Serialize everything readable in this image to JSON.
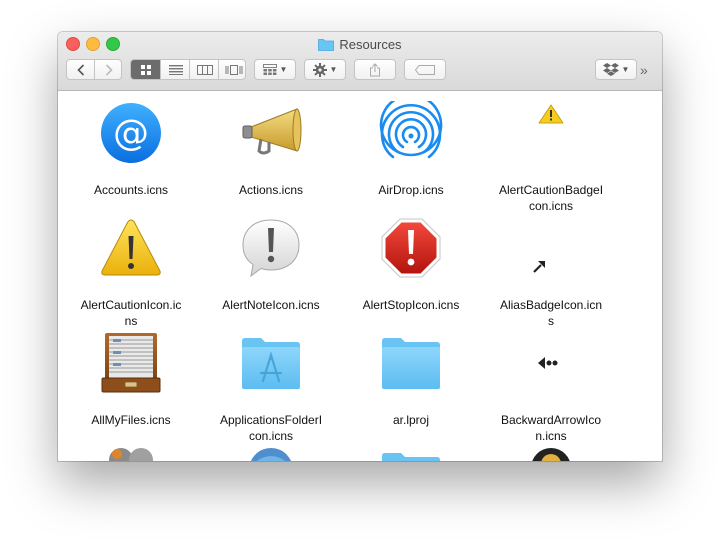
{
  "window": {
    "title": "Resources"
  },
  "toolbar": {
    "back": "‹",
    "forward": "›",
    "view_modes": [
      "icon-view",
      "list-view",
      "column-view",
      "cover-flow-view"
    ],
    "arrange": "arrange",
    "action": "action",
    "share": "share",
    "tags": "tags",
    "dropbox": "dropbox",
    "more": "»"
  },
  "files": [
    {
      "label": "Accounts.icns",
      "icon": "at-sign-icon"
    },
    {
      "label": "Actions.icns",
      "icon": "megaphone-icon"
    },
    {
      "label": "AirDrop.icns",
      "icon": "airdrop-icon"
    },
    {
      "label": "AlertCautionBadgeI\ncon.icns",
      "icon": "caution-badge-icon"
    },
    {
      "label": "AlertCautionIcon.ic\nns",
      "icon": "caution-icon"
    },
    {
      "label": "AlertNoteIcon.icns",
      "icon": "note-bubble-icon"
    },
    {
      "label": "AlertStopIcon.icns",
      "icon": "stop-icon"
    },
    {
      "label": "AliasBadgeIcon.icn\ns",
      "icon": "alias-arrow-icon"
    },
    {
      "label": "AllMyFiles.icns",
      "icon": "file-cabinet-icon"
    },
    {
      "label": "ApplicationsFolderI\ncon.icns",
      "icon": "applications-folder-icon"
    },
    {
      "label": "ar.lproj",
      "icon": "folder-icon"
    },
    {
      "label": "BackwardArrowIco\nn.icns",
      "icon": "backward-arrow-icon"
    }
  ],
  "colors": {
    "accent_blue": "#1a8cf0",
    "folder_blue": "#68c6f5",
    "caution_yellow": "#f6cd1d",
    "stop_red": "#d9261c"
  }
}
